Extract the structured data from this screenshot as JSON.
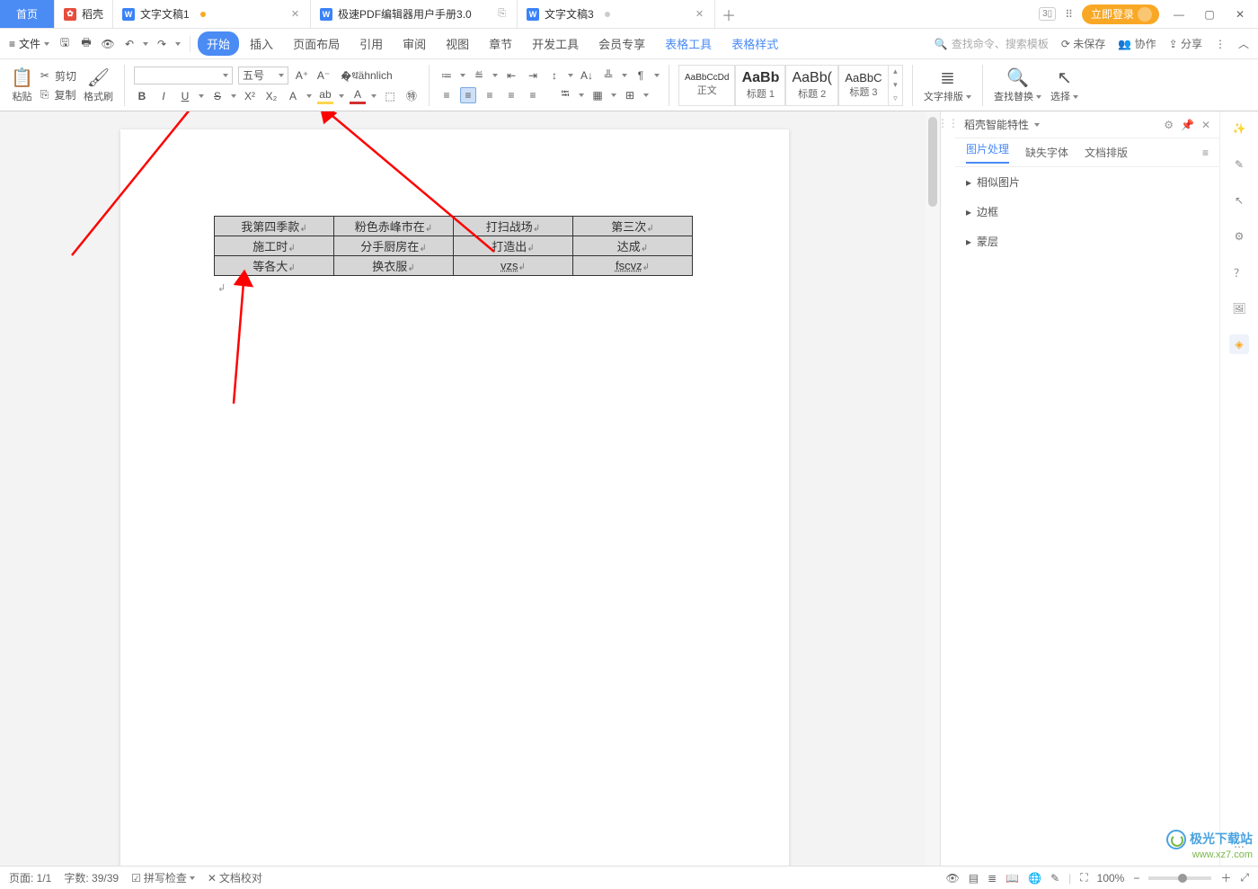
{
  "tabs": {
    "home": "首页",
    "t1": "稻壳",
    "t2": "文字文稿1",
    "t3": "极速PDF编辑器用户手册3.0",
    "t4": "文字文稿3"
  },
  "title_right": {
    "login": "立即登录"
  },
  "menubar": {
    "file": "文件",
    "tabs": [
      "开始",
      "插入",
      "页面布局",
      "引用",
      "审阅",
      "视图",
      "章节",
      "开发工具",
      "会员专享",
      "表格工具",
      "表格样式"
    ],
    "search_ph": "查找命令、搜索模板",
    "unsaved": "未保存",
    "coop": "协作",
    "share": "分享"
  },
  "ribbon": {
    "paste": "粘贴",
    "cut": "剪切",
    "copy": "复制",
    "format_painter": "格式刷",
    "font_name": "",
    "font_size_label": "五号",
    "styles": [
      {
        "preview": "AaBbCcDd",
        "label": "正文"
      },
      {
        "preview": "AaBb",
        "label": "标题 1"
      },
      {
        "preview": "AaBb(",
        "label": "标题 2"
      },
      {
        "preview": "AaBbC",
        "label": "标题 3"
      }
    ],
    "text_layout": "文字排版",
    "find_replace": "查找替换",
    "select": "选择"
  },
  "chart_data": {
    "type": "table",
    "rows": [
      [
        "我第四季款",
        "粉色赤峰市在",
        "打扫战场",
        "第三次"
      ],
      [
        "施工时",
        "分手厨房在",
        "打造出",
        "达成"
      ],
      [
        "等各大",
        "换衣服",
        "vzs",
        "fscvz"
      ]
    ]
  },
  "right_panel": {
    "title": "稻壳智能特性",
    "tabs": [
      "图片处理",
      "缺失字体",
      "文档排版"
    ],
    "items": [
      "相似图片",
      "边框",
      "蒙层"
    ]
  },
  "statusbar": {
    "page": "页面: 1/1",
    "words": "字数: 39/39",
    "spell": "拼写检查",
    "proof": "文档校对",
    "zoom": "100%"
  },
  "watermark": {
    "t1": "极光下载站",
    "t2": "www.xz7.com"
  }
}
